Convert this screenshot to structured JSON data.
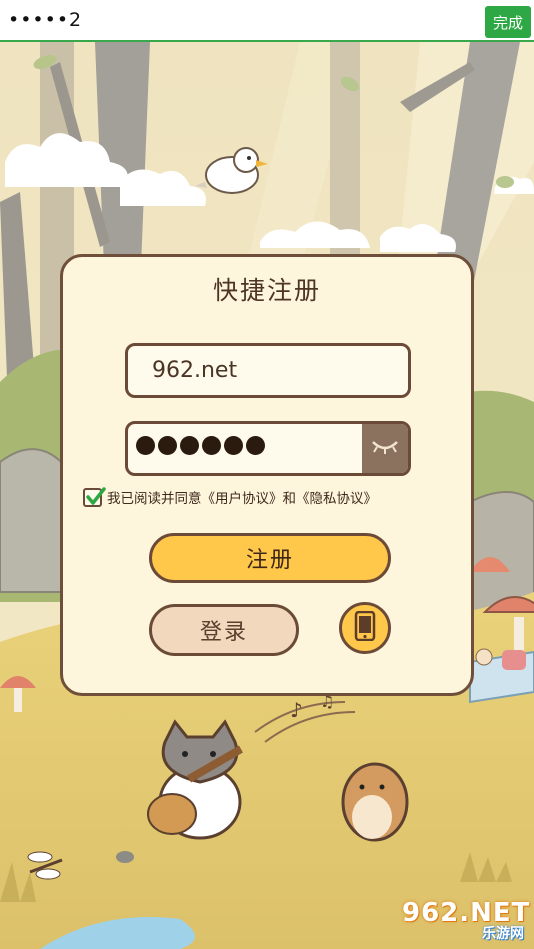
{
  "topbar": {
    "password_text": "•••••2",
    "done_label": "完成"
  },
  "panel": {
    "title": "快捷注册",
    "account_value": "962.net",
    "password_mask_count": 6,
    "agree_text": "我已阅读并同意《用户协议》和《隐私协议》",
    "agree_checked": true,
    "register_label": "注册",
    "login_label": "登录"
  },
  "icons": {
    "eye": "eye-closed-icon",
    "phone": "phone-icon",
    "check": "checkmark-icon"
  },
  "watermark": {
    "main": "962.NET",
    "sub": "乐游网"
  },
  "colors": {
    "accent_green": "#2ea844",
    "panel_bg": "#fdf5dc",
    "border_brown": "#6b4b37",
    "button_yellow": "#ffc84a",
    "login_bg": "#f2d8bd"
  }
}
